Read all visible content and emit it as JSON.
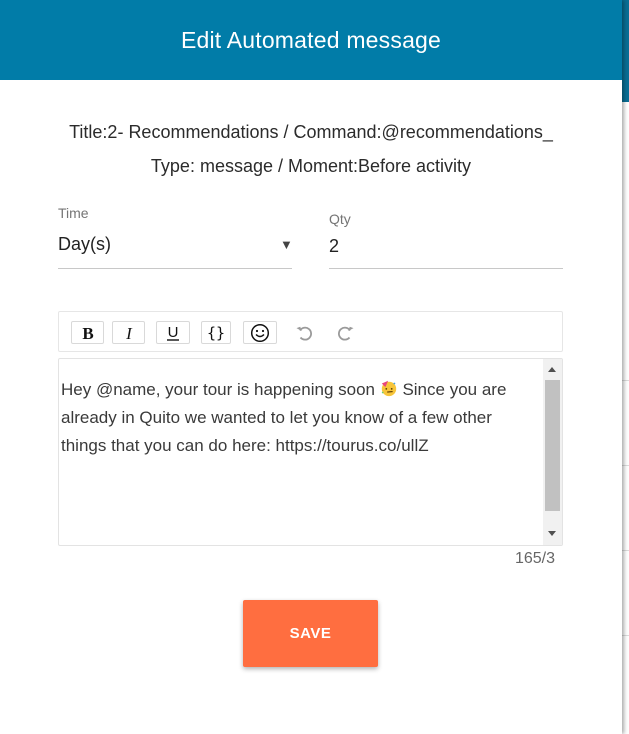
{
  "dialog": {
    "title": "Edit Automated message",
    "info_line_1": "Title:2- Recommendations / Command:@recommendations_",
    "info_line_2": "Type: message / Moment:Before activity"
  },
  "time_field": {
    "label": "Time",
    "value": "Day(s)",
    "arrow": "▼"
  },
  "qty_field": {
    "label": "Qty",
    "value": "2"
  },
  "toolbar": {
    "buttons": [
      "bold-icon",
      "italic-icon",
      "underline-icon",
      "variable-braces-icon",
      "emoji-icon",
      "undo-icon",
      "redo-icon"
    ]
  },
  "editor": {
    "text_before_emoji": "Hey @name, your tour is happening soon ",
    "text_after_emoji": " Since you are already in Quito we wanted to let you know of a few other things that you can do here: https://tourus.co/ullZ",
    "char_counter": "165/3"
  },
  "save_label": "SAVE",
  "colors": {
    "header": "#017ca8",
    "save": "#ff6e40"
  }
}
